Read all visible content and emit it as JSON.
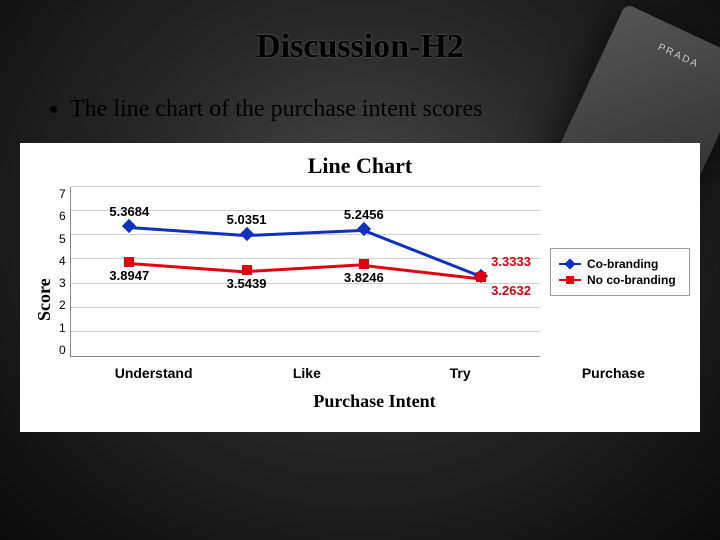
{
  "slide": {
    "title": "Discussion-H2",
    "bullet": "The line chart of the purchase intent scores"
  },
  "chart_data": {
    "type": "line",
    "title": "Line Chart",
    "xlabel": "Purchase Intent",
    "ylabel": "Score",
    "ylim": [
      0,
      7
    ],
    "yticks": [
      0,
      1,
      2,
      3,
      4,
      5,
      6,
      7
    ],
    "categories": [
      "Understand",
      "Like",
      "Try",
      "Purchase"
    ],
    "series": [
      {
        "name": "Co-branding",
        "color": "#1030c0",
        "marker": "diamond",
        "values": [
          5.3684,
          5.0351,
          5.2456,
          3.3333
        ]
      },
      {
        "name": "No co-branding",
        "color": "#e00010",
        "marker": "square",
        "values": [
          3.8947,
          3.5439,
          3.8246,
          3.2632
        ]
      }
    ],
    "end_labels": [
      {
        "series": 0,
        "text": "3.3333",
        "color": "#e00010"
      },
      {
        "series": 1,
        "text": "3.2632",
        "color": "#e00010"
      }
    ]
  },
  "legend": {
    "items": [
      "Co-branding",
      "No co-branding"
    ]
  },
  "phone_brand": "PRADA"
}
